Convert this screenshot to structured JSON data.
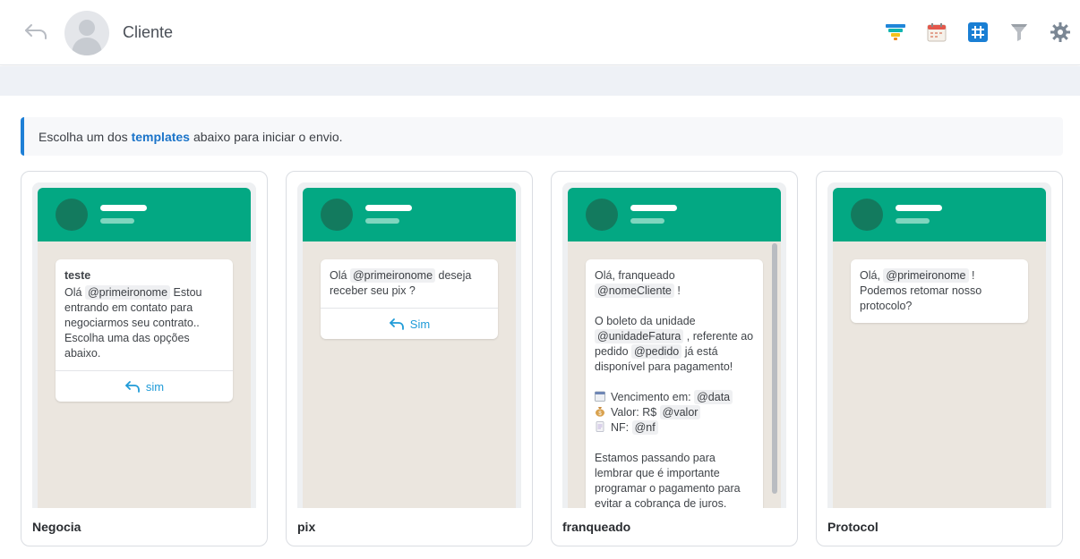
{
  "header": {
    "contact_name": "Cliente",
    "tools": [
      "funnel-color-icon",
      "calendar-icon",
      "grid-icon",
      "filter-icon",
      "gear-icon"
    ],
    "colors": {
      "accent_blue": "#1e7fd6",
      "whatsapp_green": "#03a883"
    }
  },
  "notice": {
    "before": "Escolha um dos",
    "highlight": "templates",
    "after": "abaixo para iniciar o envio."
  },
  "templates": [
    {
      "name": "Negocia",
      "title": "teste",
      "body": [
        {
          "t": "Olá "
        },
        {
          "v": "@primeironome"
        },
        {
          "t": " Estou entrando em contato para negociarmos seu contrato.. Escolha uma das opções abaixo."
        }
      ],
      "reply_label": "sim"
    },
    {
      "name": "pix",
      "title": "",
      "body": [
        {
          "t": "Olá "
        },
        {
          "v": "@primeironome"
        },
        {
          "t": " deseja receber seu pix ?"
        }
      ],
      "reply_label": "Sim"
    },
    {
      "name": "franqueado",
      "title": "",
      "body_lines": [
        "Olá, franqueado",
        "@nomeCliente !",
        "",
        "O boleto da unidade",
        "@unidadeFatura , referente ao pedido @pedido já está disponível para pagamento!",
        "",
        "Vencimento em: @data",
        "Valor: R$ @valor",
        "NF: @nf",
        "",
        "Estamos passando para lembrar que é importante programar o pagamento para evitar a cobrança de juros."
      ],
      "vars": {
        "nome": "@nomeCliente",
        "unidade": "@unidadeFatura",
        "pedido": "@pedido",
        "data": "@data",
        "valor": "@valor",
        "nf": "@nf"
      },
      "text": {
        "l1": "Olá, franqueado",
        "l2_after": " !",
        "l3": "O boleto da unidade",
        "l4_after": " , referente ao pedido ",
        "l4_end": " já está disponível para pagamento!",
        "venc": "Vencimento em: ",
        "valor": "Valor: R$ ",
        "nf": "NF: ",
        "final": "Estamos passando para lembrar que é importante programar o pagamento para evitar a cobrança de juros."
      },
      "reply_label": ""
    },
    {
      "name": "Protocol",
      "title": "",
      "body": [
        {
          "t": "Olá, "
        },
        {
          "v": "@primeironome"
        },
        {
          "t": " ! Podemos retomar nosso protocolo?"
        }
      ],
      "reply_label": ""
    }
  ]
}
